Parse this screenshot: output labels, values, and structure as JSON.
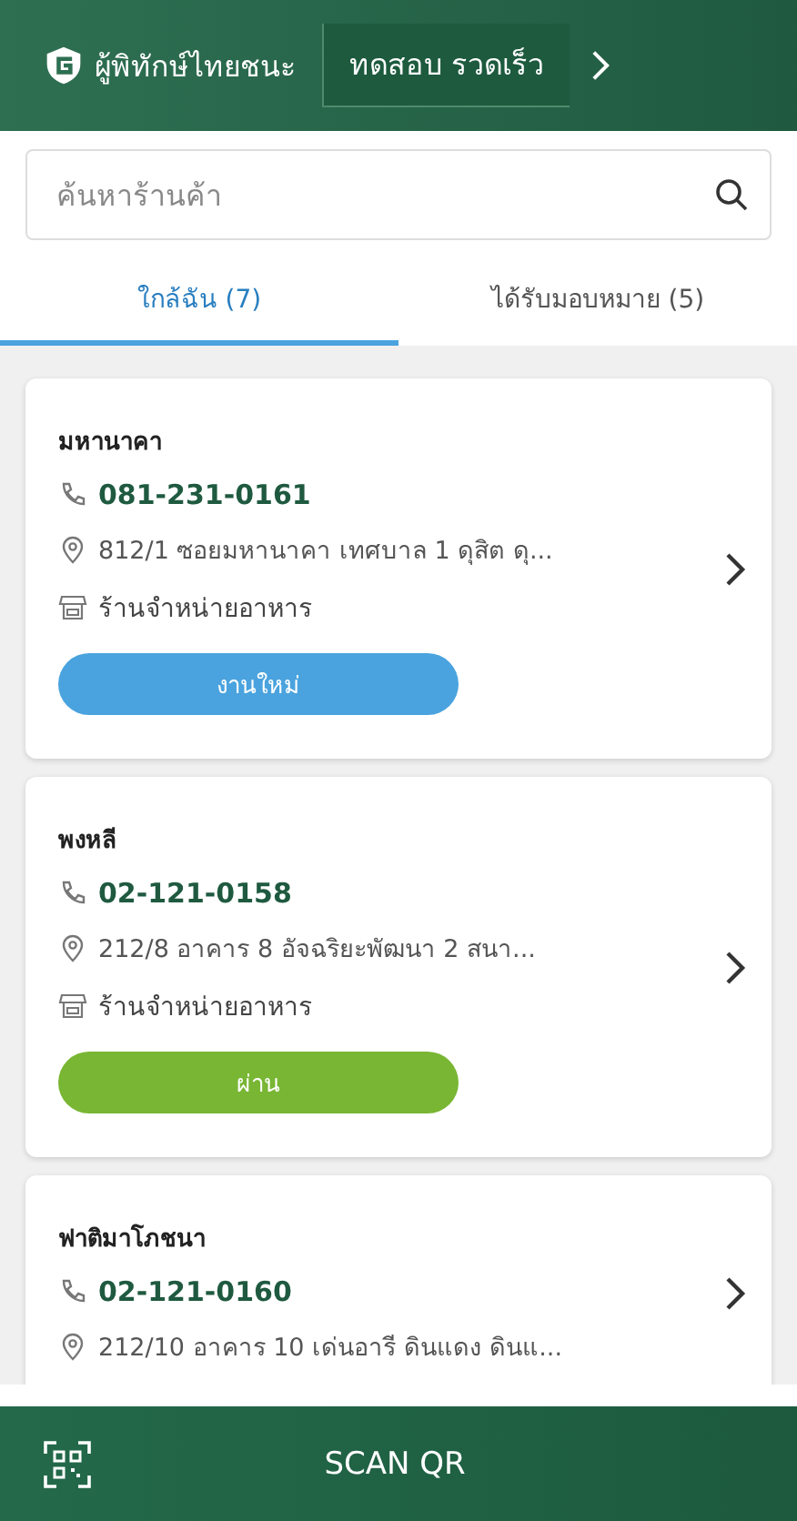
{
  "header": {
    "title": "ผู้พิทักษ์ไทยชนะ",
    "action": "ทดสอบ รวดเร็ว"
  },
  "search": {
    "placeholder": "ค้นหาร้านค้า"
  },
  "tabs": [
    {
      "label": "ใกล้ฉัน (7)",
      "selected": true
    },
    {
      "label": "ได้รับมอบหมาย (5)",
      "selected": false
    }
  ],
  "stores": [
    {
      "name": "มหานาคา",
      "phone": "081-231-0161",
      "address": "812/1 ซอยมหานาคา เทศบาล 1 ดุสิต ดุ...",
      "category": "ร้านจำหน่ายอาหาร",
      "status": {
        "label": "งานใหม่",
        "kind": "new"
      }
    },
    {
      "name": "พงหลี",
      "phone": "02-121-0158",
      "address": "212/8 อาคาร 8 อัจฉริยะพัฒนา 2 สนา...",
      "category": "ร้านจำหน่ายอาหาร",
      "status": {
        "label": "ผ่าน",
        "kind": "passed"
      }
    },
    {
      "name": "ฟาติมาโภชนา",
      "phone": "02-121-0160",
      "address": "212/10 อาคาร 10 เด่นอารี ดินแดง ดินแ..."
    }
  ],
  "bottom_bar": {
    "label": "SCAN QR"
  }
}
